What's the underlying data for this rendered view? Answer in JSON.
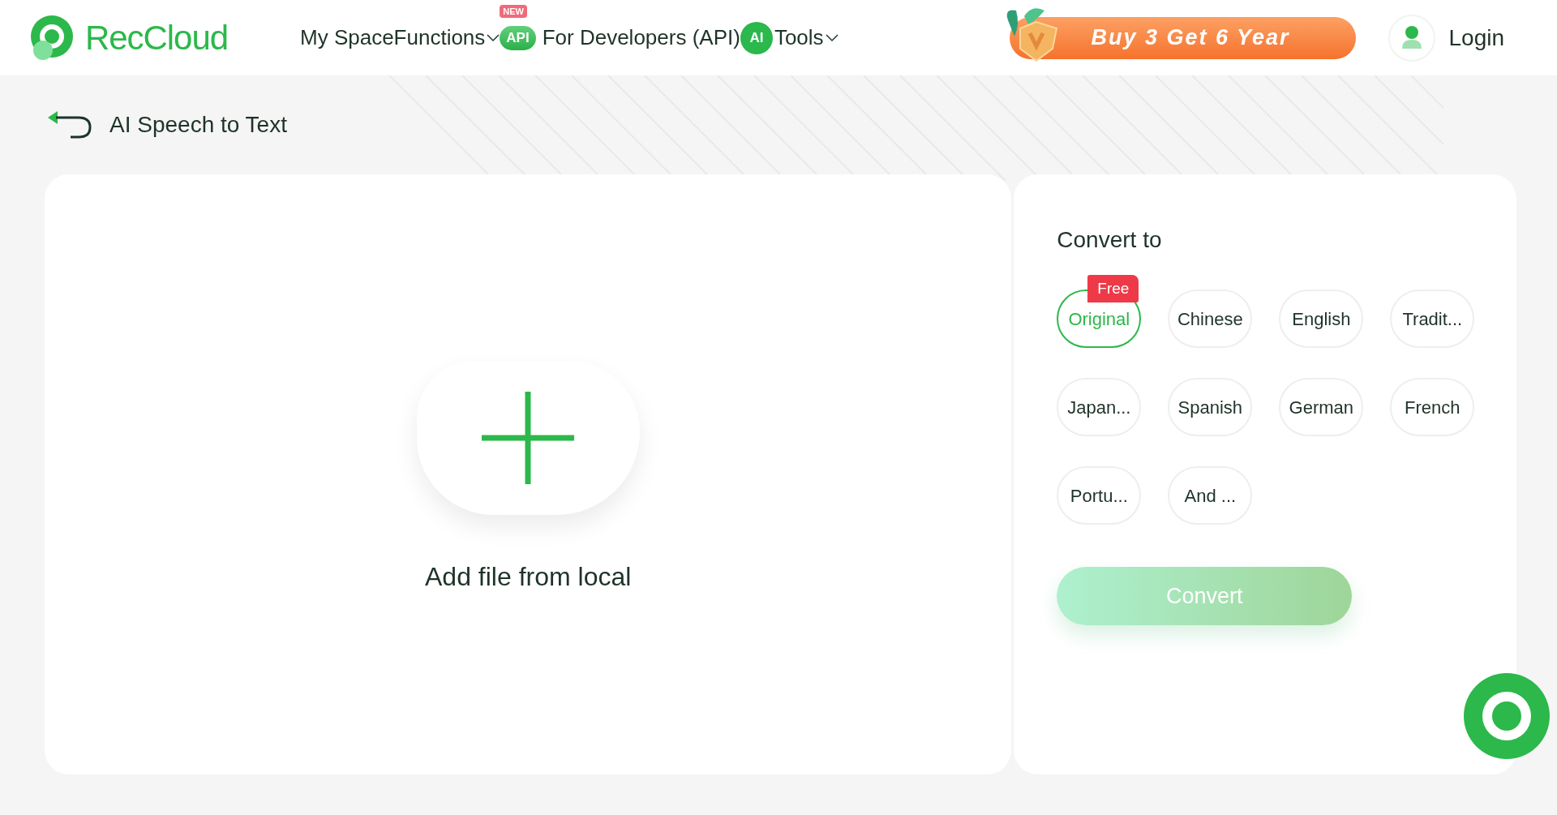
{
  "header": {
    "logo": "RecCloud",
    "nav": [
      {
        "label": "My Space",
        "kind": "link"
      },
      {
        "label": "Functions",
        "kind": "dropdown"
      },
      {
        "label": "For Developers (API)",
        "kind": "api",
        "badge": "NEW",
        "icon_text": "API"
      },
      {
        "label": "Tools",
        "kind": "ai",
        "icon_text": "AI"
      }
    ],
    "promo": "Buy 3 Get 6 Year",
    "login": "Login"
  },
  "page_title": "AI Speech to Text",
  "upload": {
    "label": "Add file from local"
  },
  "convert_panel": {
    "title": "Convert to",
    "languages": [
      {
        "label": "Original",
        "selected": true,
        "badge": "Free"
      },
      {
        "label": "Chinese",
        "selected": false
      },
      {
        "label": "English",
        "selected": false
      },
      {
        "label": "Tradit...",
        "selected": false
      },
      {
        "label": "Japan...",
        "selected": false
      },
      {
        "label": "Spanish",
        "selected": false
      },
      {
        "label": "German",
        "selected": false
      },
      {
        "label": "French",
        "selected": false
      },
      {
        "label": "Portu...",
        "selected": false
      },
      {
        "label": "And ...",
        "selected": false
      }
    ],
    "button": {
      "label": "Convert",
      "disabled": true
    }
  }
}
